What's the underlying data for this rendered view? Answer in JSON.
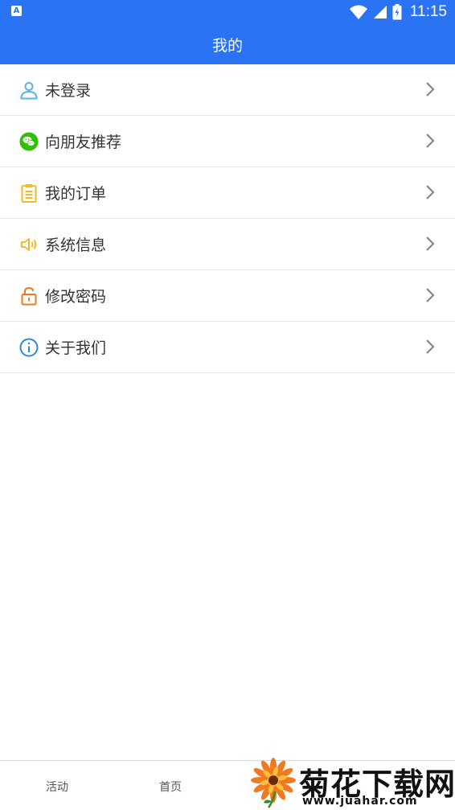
{
  "status_bar": {
    "app_badge": "A",
    "time": "11:15"
  },
  "header": {
    "title": "我的"
  },
  "menu": {
    "items": [
      {
        "label": "未登录",
        "icon": "user-icon",
        "color": "#5ab2e8"
      },
      {
        "label": "向朋友推荐",
        "icon": "wechat-icon",
        "color": "#2dc100"
      },
      {
        "label": "我的订单",
        "icon": "clipboard-icon",
        "color": "#f5b826"
      },
      {
        "label": "系统信息",
        "icon": "speaker-icon",
        "color": "#f5b826"
      },
      {
        "label": "修改密码",
        "icon": "unlock-icon",
        "color": "#f07a1f"
      },
      {
        "label": "关于我们",
        "icon": "info-icon",
        "color": "#2a88d8"
      }
    ]
  },
  "tabbar": {
    "tabs": [
      {
        "label": "活动"
      },
      {
        "label": "首页"
      }
    ]
  },
  "watermark": {
    "title": "菊花下载网",
    "url": "www.juahar.com"
  }
}
